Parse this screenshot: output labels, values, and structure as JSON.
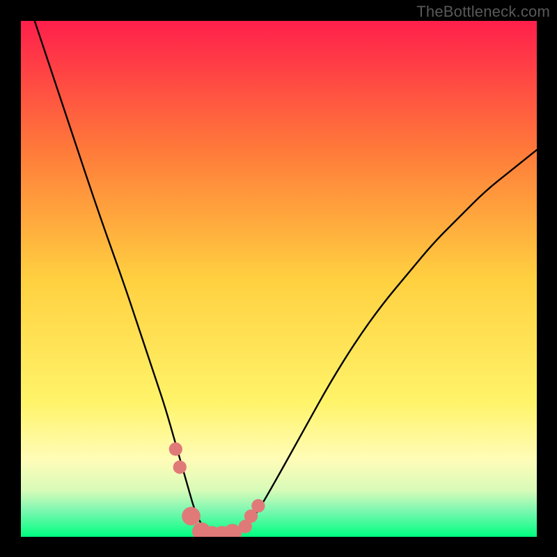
{
  "watermark": "TheBottleneck.com",
  "colors": {
    "background": "#000000",
    "gradient_top": "#ff1f4b",
    "gradient_mid_upper": "#ff7a3a",
    "gradient_mid": "#ffd040",
    "gradient_mid_lower": "#fff46a",
    "gradient_soft_green": "#c8f9a3",
    "gradient_green": "#30f79a",
    "gradient_bottom": "#00ff7f",
    "curve": "#000000",
    "markers": "#e07a78"
  },
  "chart_data": {
    "type": "line",
    "title": "",
    "xlabel": "",
    "ylabel": "",
    "xlim": [
      0,
      100
    ],
    "ylim": [
      0,
      100
    ],
    "series": [
      {
        "name": "bottleneck-curve",
        "x": [
          0,
          5,
          10,
          15,
          20,
          23,
          26,
          28,
          30,
          32,
          34,
          36,
          38,
          40,
          43,
          46,
          50,
          55,
          60,
          65,
          70,
          75,
          80,
          85,
          90,
          95,
          100
        ],
        "y": [
          108,
          93,
          78,
          63,
          49,
          40,
          31,
          25,
          18,
          11,
          4,
          1,
          0,
          0,
          1,
          5,
          12,
          21,
          30,
          38,
          45,
          51,
          57,
          62,
          67,
          71,
          75
        ]
      }
    ],
    "markers": [
      {
        "x": 30.0,
        "y": 17.0,
        "r": 1.3
      },
      {
        "x": 30.8,
        "y": 13.5,
        "r": 1.3
      },
      {
        "x": 33.0,
        "y": 4.0,
        "r": 1.8
      },
      {
        "x": 35.0,
        "y": 1.0,
        "r": 1.8
      },
      {
        "x": 37.0,
        "y": 0.3,
        "r": 1.8
      },
      {
        "x": 39.0,
        "y": 0.3,
        "r": 1.8
      },
      {
        "x": 41.0,
        "y": 0.7,
        "r": 1.8
      },
      {
        "x": 43.5,
        "y": 2.0,
        "r": 1.3
      },
      {
        "x": 44.6,
        "y": 4.0,
        "r": 1.3
      },
      {
        "x": 46.0,
        "y": 6.0,
        "r": 1.3
      }
    ]
  }
}
